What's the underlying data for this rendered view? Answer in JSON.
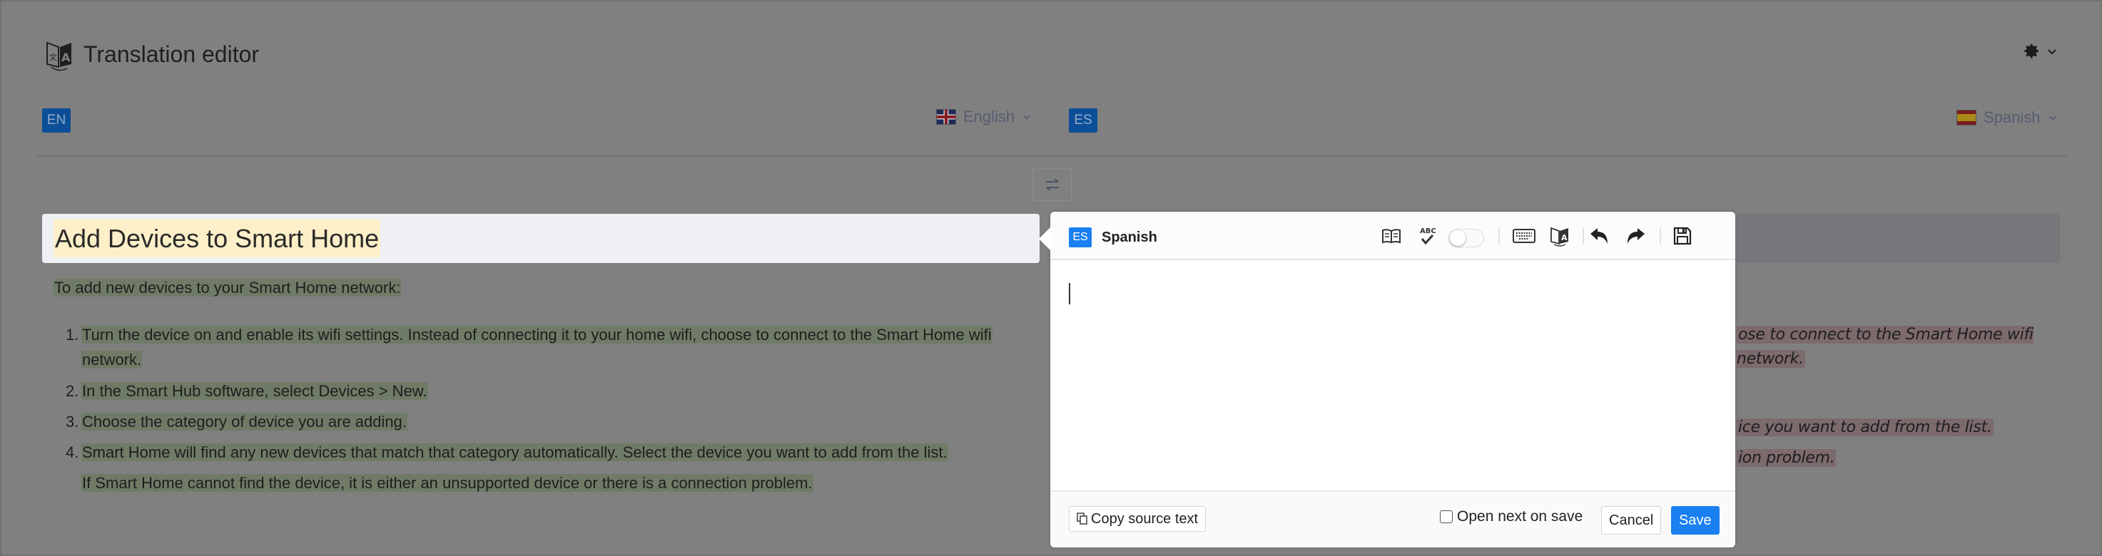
{
  "app": {
    "title": "Translation editor",
    "settings_icon": "gear-icon"
  },
  "source": {
    "lang_code": "EN",
    "lang_label": "English",
    "heading": "Add Devices to Smart Home",
    "intro": "To add new devices to your Smart Home network:",
    "list": [
      {
        "num": "1.",
        "text_line1": "Turn the device on and enable its wifi settings. Instead of connecting it to your home wifi, choose to connect to the Smart Home wifi",
        "text_line2": "network."
      },
      {
        "num": "2.",
        "text": "In the Smart Hub software, select Devices > New."
      },
      {
        "num": "3.",
        "text": "Choose the category of device you are adding."
      },
      {
        "num": "4.",
        "text": "Smart Home will find any new devices that match that category automatically. Select the device you want to add from the list."
      }
    ],
    "note": "If Smart Home cannot find the device, it is either an unsupported device or there is a connection problem."
  },
  "target": {
    "lang_code": "ES",
    "lang_label": "Spanish",
    "visible_fragments": [
      "ose to connect to the Smart Home wifi network.",
      "ice you want to add from the list.",
      "ion problem."
    ]
  },
  "swap_icon": "swap-arrows-icon",
  "editor": {
    "lang_code": "ES",
    "lang_label": "Spanish",
    "content": "",
    "toolbar": {
      "glossary": "book-icon",
      "spellcheck": "spellcheck-abc-icon",
      "toggle_on": false,
      "keyboard": "keyboard-icon",
      "machine_translate": "translate-icon",
      "undo": "undo-icon",
      "redo": "redo-icon",
      "save": "save-floppy-icon"
    },
    "footer": {
      "copy_source_label": "Copy source text",
      "open_next_label": "Open next on save",
      "open_next_checked": false,
      "cancel_label": "Cancel",
      "save_label": "Save"
    }
  },
  "colors": {
    "accent": "#1a7ff0",
    "overlay": "#808080",
    "segment_highlight": "#6f7b66",
    "heading_highlight": "#fdf0c8",
    "untranslated_highlight": "#7c6a6d"
  }
}
